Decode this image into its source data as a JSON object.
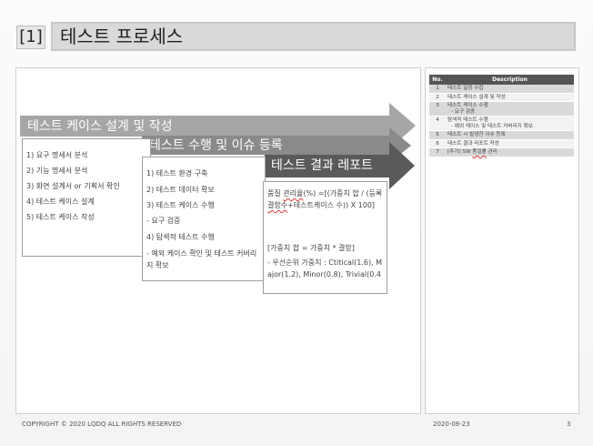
{
  "header": {
    "section_number": "[1]",
    "title": "테스트 프로세스"
  },
  "arrows": [
    {
      "label": "테스트 케이스 설계 및 작성",
      "color": "#a6a6a6"
    },
    {
      "label": "테스트 수행 및 이슈 등록",
      "color": "#8a8a8a"
    },
    {
      "label": "테스트 결과 레포트",
      "color": "#5a5a5a"
    }
  ],
  "box1": {
    "items": [
      "1) 요구 명세서 분석",
      "2) 기능 명세서 분석",
      "3) 화면 설계서 or 기획서 확인",
      "4) 테스트 케이스 설계",
      "5) 테스트 케이스 작성"
    ]
  },
  "box2": {
    "items": [
      "1) 테스트 환경 구축",
      "2) 테스트 데이터 확보",
      "3) 테스트 케이스 수행",
      "- 요구 검증",
      "4) 탐색적 테스트 수행",
      "- 예외 케이스 확인 및 테스트 커버리지 확보"
    ]
  },
  "box3": {
    "formula_prefix": "품질 ",
    "formula_wavy1": "관리율",
    "formula_mid": "(%) =[(가중치 합 / (등록 ",
    "formula_wavy2": "결함수",
    "formula_end": "+테스트케이스 수)) X 100]",
    "weight_line": "[가중치 합 = 가중치 * 결함]",
    "priority_line": "- 우선순위 가중치 : Ctitical(1.6), Major(1.2), Minor(0.8), Trivial(0.4"
  },
  "table": {
    "headers": [
      "No.",
      "Description"
    ],
    "rows": [
      {
        "no": "1",
        "desc": "테스트 일정 수립",
        "sub": ""
      },
      {
        "no": "2",
        "desc": "테스트 케이스 설계 및 작성",
        "sub": ""
      },
      {
        "no": "3",
        "desc": "테스트 케이스 수행",
        "sub": "- 요구 검증"
      },
      {
        "no": "4",
        "desc": "탐색적 테스트 수행",
        "sub": "- 예외 케이스 및 테스트 커버리지 확보"
      },
      {
        "no": "5",
        "desc": "테스트 시 발생한 이슈 등록",
        "sub": ""
      },
      {
        "no": "6",
        "desc": "테스트 결과 리포트 작성",
        "sub": ""
      },
      {
        "no": "7",
        "desc_prefix": "[추가] SW ",
        "desc_wavy": "품질률",
        "desc_suffix": " 관리",
        "sub": ""
      }
    ]
  },
  "footer": {
    "copyright": "COPYRIGHT © 2020 LQDQ ALL RIGHTS RESERVED",
    "date": "2020-08-23",
    "page": "3"
  }
}
